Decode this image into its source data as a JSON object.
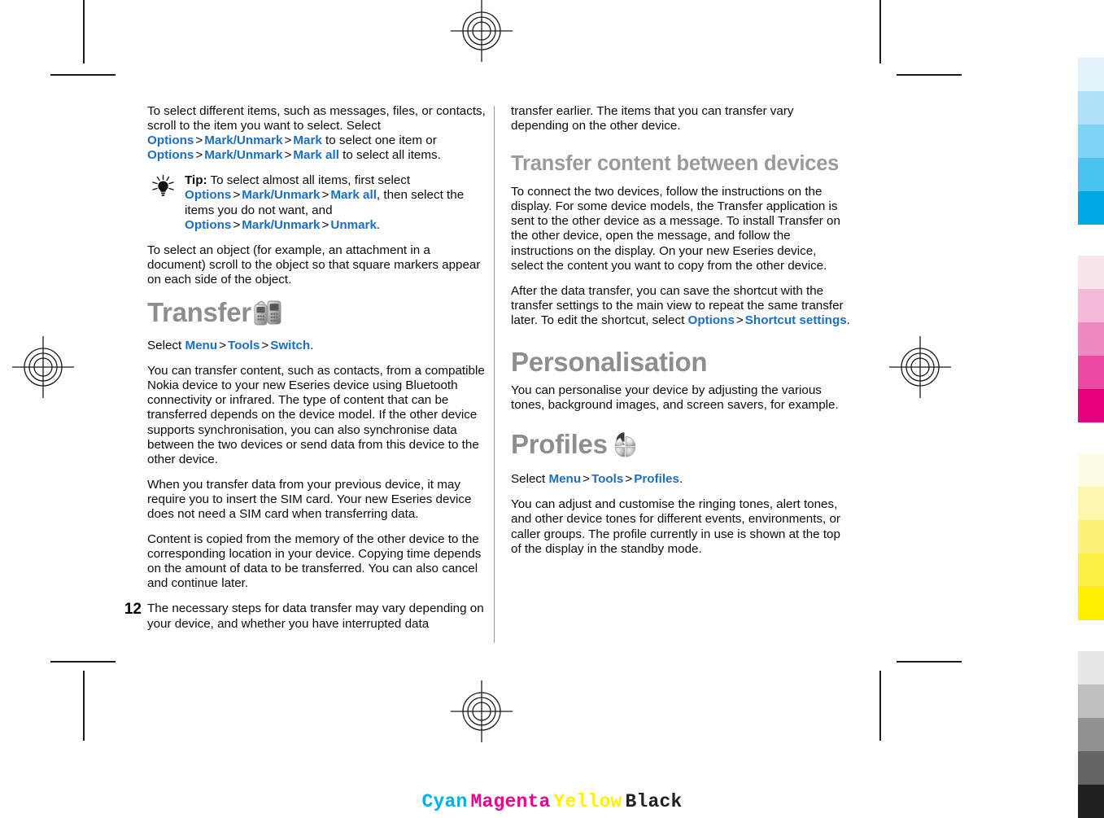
{
  "document": {
    "page_number": "12",
    "press_marks": {
      "registration_icon": "registration-target-icon",
      "crop_mark_icon": "crop-mark-line"
    }
  },
  "left_column": {
    "paragraph_1": {
      "run_1": "To select different items, such as messages, files, or contacts, scroll to the item you want to select. Select ",
      "ui_1": "Options",
      "sep_1": ">",
      "ui_2": "Mark/Unmark",
      "sep_2": ">",
      "ui_3": "Mark",
      "run_2": " to select one item or ",
      "ui_4": "Options",
      "sep_3": ">",
      "ui_5": "Mark/Unmark",
      "sep_4": ">",
      "ui_6": "Mark all",
      "run_3": " to select all items."
    },
    "tip": {
      "icon": "lightbulb-tip-icon",
      "label": "Tip:",
      "run_1": " To select almost all items, first select ",
      "ui_1": "Options",
      "sep_1": ">",
      "ui_2": "Mark/Unmark",
      "sep_2": ">",
      "ui_3": "Mark all",
      "run_2": ", then select the items you do not want, and ",
      "ui_4": "Options",
      "sep_3": ">",
      "ui_5": "Mark/Unmark",
      "sep_4": ">",
      "ui_6": "Unmark",
      "run_3": "."
    },
    "paragraph_2": "To select an object (for example, an attachment in a document) scroll to the object so that square markers appear on each side of the object.",
    "heading_transfer": {
      "text": "Transfer",
      "icon": "transfer-devices-icon"
    },
    "select_path": {
      "run_1": "Select ",
      "ui_1": "Menu",
      "sep_1": ">",
      "ui_2": "Tools",
      "sep_2": ">",
      "ui_3": "Switch",
      "run_2": "."
    },
    "paragraph_3": "You can transfer content, such as contacts, from a compatible Nokia device to your new Eseries device using Bluetooth connectivity or infrared. The type of content that can be transferred depends on the device model. If the other device supports synchronisation, you can also synchronise data between the two devices or send data from this device to the other device.",
    "paragraph_4": "When you transfer data from your previous device, it may require you to insert the SIM card. Your new Eseries device does not need a SIM card when transferring data.",
    "paragraph_5": "Content is copied from the memory of the other device to the corresponding location in your device. Copying time depends on the amount of data to be transferred. You can also cancel and continue later.",
    "paragraph_6": "The necessary steps for data transfer may vary depending on your device, and whether you have interrupted data"
  },
  "right_column": {
    "paragraph_1": "transfer earlier. The items that you can transfer vary depending on the other device.",
    "heading_transfer_content": "Transfer content between devices",
    "paragraph_2": "To connect the two devices, follow the instructions on the display. For some device models, the Transfer application is sent to the other device as a message. To install Transfer on the other device, open the message, and follow the instructions on the display. On your new Eseries device, select the content you want to copy from the other device.",
    "paragraph_3": {
      "run_1": "After the data transfer, you can save the shortcut with the transfer settings to the main view to repeat the same transfer later. To edit the shortcut, select ",
      "ui_1": "Options",
      "sep_1": ">",
      "ui_2": "Shortcut settings",
      "run_2": "."
    },
    "heading_personalisation": "Personalisation",
    "paragraph_4": "You can personalise your device by adjusting the various tones, background images, and screen savers, for example.",
    "heading_profiles": {
      "text": "Profiles",
      "icon": "profiles-pie-icon"
    },
    "select_path": {
      "run_1": "Select ",
      "ui_1": "Menu",
      "sep_1": ">",
      "ui_2": "Tools",
      "sep_2": ">",
      "ui_3": "Profiles",
      "run_2": "."
    },
    "paragraph_5": "You can adjust and customise the ringing tones, alert tones, and other device tones for different events, environments, or caller groups. The profile currently in use is shown at the top of the display in the standby mode."
  },
  "calibration_strip": {
    "groups": [
      {
        "name": "cyan",
        "swatches": [
          "#e4f3fb",
          "#b0e1f8",
          "#7ed4f4",
          "#4ac3ee",
          "#00a7e5"
        ]
      },
      {
        "name": "magenta",
        "swatches": [
          "#fae4ef",
          "#f6b8d8",
          "#f089c2",
          "#ec49a5",
          "#e6007e"
        ]
      },
      {
        "name": "yellow",
        "swatches": [
          "#fffce4",
          "#fdf7b2",
          "#fdf278",
          "#fdee45",
          "#fff000"
        ]
      },
      {
        "name": "black",
        "swatches": [
          "#e7e7e7",
          "#bfbfbf",
          "#919191",
          "#666565",
          "#231f20"
        ]
      }
    ]
  },
  "cmyk_footer": {
    "labels": [
      {
        "text": "Cyan",
        "color": "#00aeef"
      },
      {
        "text": "Magenta",
        "color": "#ec008c"
      },
      {
        "text": "Yellow",
        "color": "#fff200"
      },
      {
        "text": "Black",
        "color": "#231f20"
      }
    ]
  }
}
